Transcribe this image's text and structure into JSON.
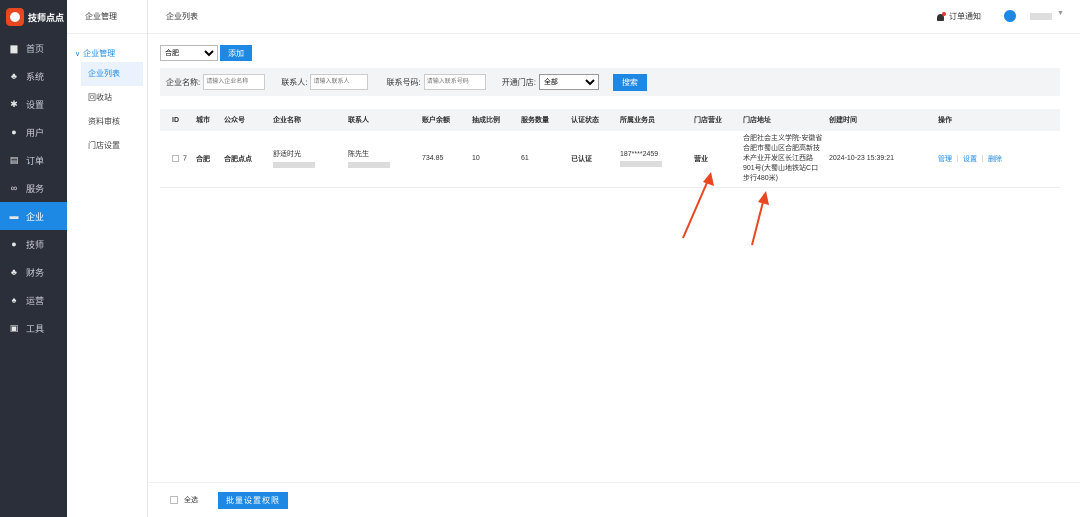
{
  "app": {
    "name": "技师点点"
  },
  "sidebar": {
    "items": [
      {
        "label": "首页",
        "icon": "monitor-icon",
        "glyph": "▆"
      },
      {
        "label": "系统",
        "icon": "sitemap-icon",
        "glyph": "♣"
      },
      {
        "label": "设置",
        "icon": "gear-icon",
        "glyph": "✱"
      },
      {
        "label": "用户",
        "icon": "user-icon",
        "glyph": "●"
      },
      {
        "label": "订单",
        "icon": "clipboard-icon",
        "glyph": "▤"
      },
      {
        "label": "服务",
        "icon": "link-icon",
        "glyph": "∞"
      },
      {
        "label": "企业",
        "icon": "building-icon",
        "glyph": "▬"
      },
      {
        "label": "技师",
        "icon": "person-icon",
        "glyph": "●"
      },
      {
        "label": "财务",
        "icon": "finance-icon",
        "glyph": "♣"
      },
      {
        "label": "运营",
        "icon": "operations-icon",
        "glyph": "♠"
      },
      {
        "label": "工具",
        "icon": "toolbox-icon",
        "glyph": "▣"
      }
    ]
  },
  "subnav": {
    "title": "企业管理",
    "group": "企业管理",
    "items": [
      "企业列表",
      "回收站",
      "资料审核",
      "门店设置"
    ]
  },
  "header": {
    "breadcrumb": "企业列表",
    "notify": "订单通知"
  },
  "toolbar": {
    "city_value": "合肥",
    "add_label": "添加"
  },
  "filter": {
    "company_label": "企业名称:",
    "company_placeholder": "请输入企业名称",
    "contact_label": "联系人:",
    "contact_placeholder": "请输入联系人",
    "phone_label": "联系号码:",
    "phone_placeholder": "请输入联系号码",
    "open_label": "开通门店:",
    "open_value": "全部",
    "search_label": "搜索"
  },
  "table": {
    "columns": [
      "ID",
      "城市",
      "公众号",
      "企业名称",
      "联系人",
      "账户余额",
      "抽成比例",
      "服务数量",
      "认证状态",
      "所属业务员",
      "门店营业",
      "门店地址",
      "创建时间",
      "操作"
    ],
    "rows": [
      {
        "id": "7",
        "city": "合肥",
        "account": "合肥点点",
        "company": "舒适时光",
        "contact": "陈先生",
        "balance": "734.85",
        "ratio": "10",
        "services": "61",
        "cert": "已认证",
        "salesman": "187****2459",
        "store_status": "营业",
        "address": "合肥社会主义学院-安徽省合肥市蜀山区合肥高新技术产业开发区长江西路901号(大蜀山地铁站C口步行480米)",
        "created": "2024-10-23 15:39:21",
        "actions": [
          "管理",
          "设置",
          "删除"
        ]
      }
    ]
  },
  "footer": {
    "select_all": "全选",
    "batch_label": "批量设置权限"
  },
  "colors": {
    "accent": "#1e88e5",
    "sidebar_bg": "#2b2f3a",
    "success": "#2e7d32",
    "annotation": "#e8471f"
  }
}
